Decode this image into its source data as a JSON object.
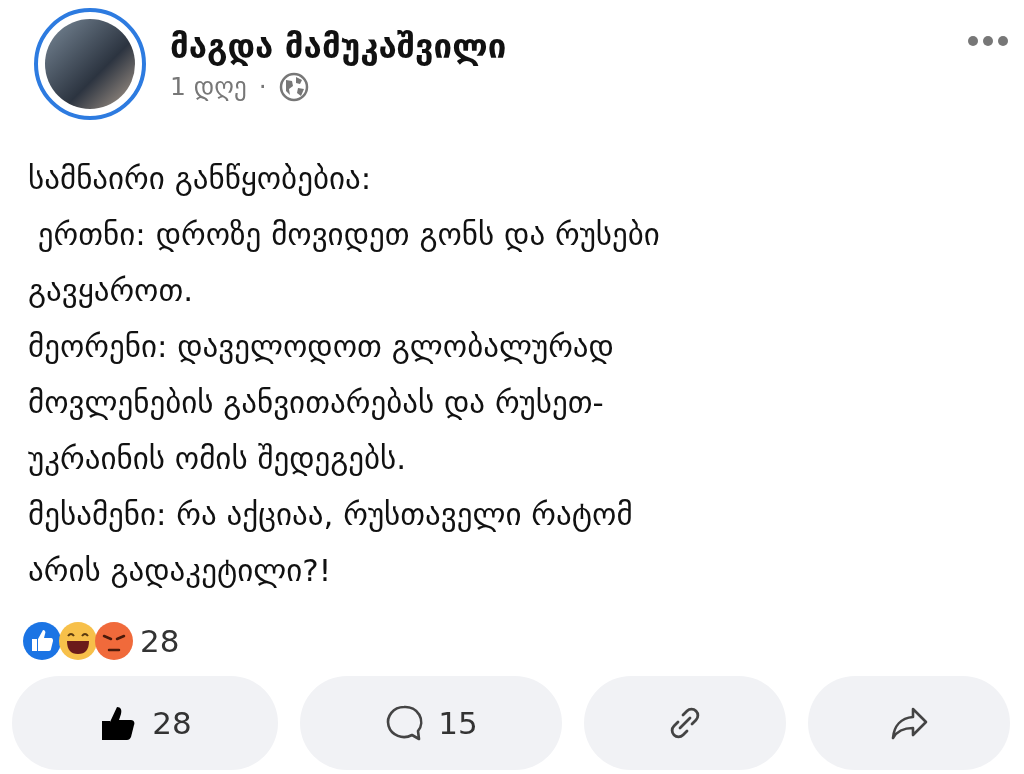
{
  "post": {
    "author": "მაგდა მამუკაშვილი",
    "time": "1 დღე",
    "separator": "·",
    "lines": [
      "სამნაირი განწყობებია:",
      " ერთნი: დროზე მოვიდეთ გონს და რუსები",
      "გავყაროთ.",
      "მეორენი: დაველოდოთ გლობალურად",
      "მოვლენების განვითარებას და რუსეთ-",
      "უკრაინის ომის შედეგებს.",
      "მესამენი: რა აქციაა, რუსთაველი რატომ",
      "არის გადაკეტილი?!"
    ]
  },
  "reactions": {
    "count": "28"
  },
  "actions": [
    {
      "kind": "like",
      "label": "28"
    },
    {
      "kind": "comment",
      "label": "15"
    },
    {
      "kind": "link"
    },
    {
      "kind": "share"
    }
  ]
}
